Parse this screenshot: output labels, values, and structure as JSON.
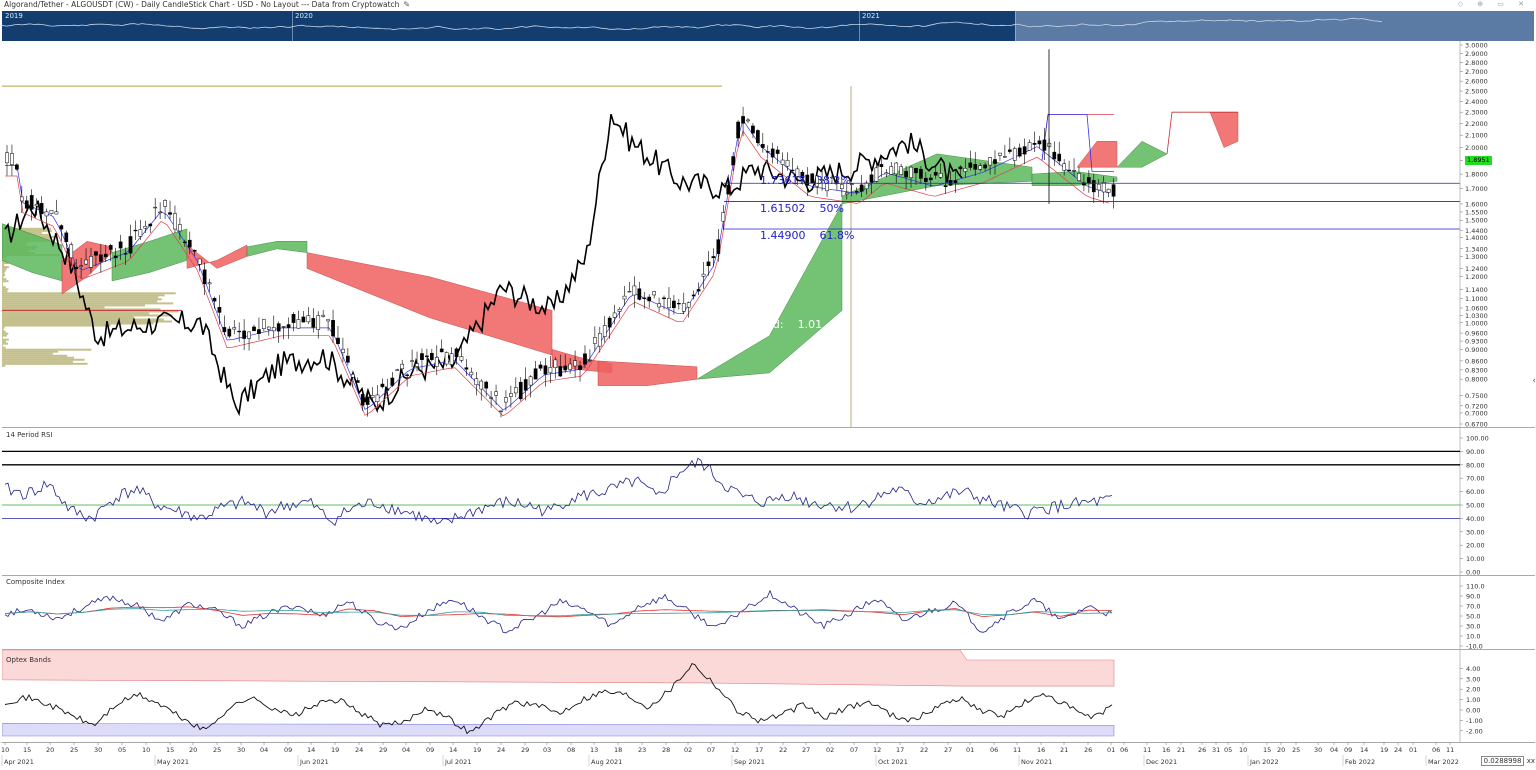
{
  "header": {
    "title": "Algorand/Tether - ALGOUSDT (CW) - Daily CandleStick Chart - USD - No Layout --- Data from Cryptowatch",
    "edit_icon": "pencil-icon",
    "window_icons": [
      "diamond-icon",
      "pin-icon",
      "restore-icon",
      "close-icon"
    ]
  },
  "navigator": {
    "years": [
      "2019",
      "2020",
      "2021"
    ]
  },
  "colors": {
    "kumo_bull": "#5cb85c",
    "kumo_bear": "#f06060",
    "tenkan": "#3333ee",
    "kijun": "#e04050",
    "price_line": "#000000",
    "fib_line": "#2222cc",
    "last_price_bg": "#22dd22",
    "nav_bg": "#133d6e"
  },
  "main_panel": {
    "price_axis": [
      "3.0000",
      "2.9000",
      "2.8000",
      "2.7000",
      "2.6000",
      "2.5000",
      "2.4000",
      "2.3000",
      "2.2000",
      "2.1000",
      "2.0000",
      "1.9000",
      "1.8000",
      "1.7000",
      "1.6000",
      "1.5500",
      "1.5000",
      "1.4400",
      "1.4000",
      "1.3400",
      "1.3000",
      "1.2400",
      "1.2000",
      "1.1400",
      "1.1000",
      "1.0600",
      "1.0300",
      "1.0000",
      "0.9600",
      "0.9300",
      "0.9000",
      "0.8600",
      "0.8300",
      "0.8000",
      "0.7500",
      "0.7200",
      "0.7000",
      "0.6700"
    ],
    "last_price": "1.8951",
    "fib_levels": [
      {
        "value": "1.73617",
        "pct": "38.2%"
      },
      {
        "value": "1.61502",
        "pct": "50%"
      },
      {
        "value": "1.44900",
        "pct": "61.8%"
      }
    ],
    "end_label": "End:",
    "end_value": "1.01"
  },
  "rsi_panel": {
    "name": "14 Period RSI",
    "axis": [
      "100.00",
      "90.00",
      "80.00",
      "70.00",
      "60.00",
      "50.00",
      "40.00",
      "30.00",
      "20.00",
      "10.00",
      "0.00"
    ]
  },
  "composite_panel": {
    "name": "Composite Index",
    "axis": [
      "110.0",
      "90.0",
      "70.0",
      "50.0",
      "30.0",
      "10.0",
      "-10.0"
    ]
  },
  "optex_panel": {
    "name": "Optex Bands",
    "axis": [
      "4.00",
      "3.00",
      "2.00",
      "1.00",
      "0.00",
      "-1.00",
      "-2.00"
    ]
  },
  "x_axis": {
    "days": [
      "10",
      "15",
      "20",
      "25",
      "30",
      "05",
      "10",
      "15",
      "20",
      "25",
      "30",
      "04",
      "09",
      "14",
      "19",
      "24",
      "29",
      "04",
      "09",
      "14",
      "19",
      "24",
      "29",
      "03",
      "08",
      "13",
      "18",
      "23",
      "28",
      "02",
      "07",
      "12",
      "17",
      "22",
      "27",
      "02",
      "07",
      "12",
      "17",
      "22",
      "27",
      "01",
      "06",
      "11",
      "16",
      "21",
      "26",
      "01",
      "06",
      "11",
      "16",
      "21",
      "26",
      "31",
      "05",
      "10",
      "15",
      "20",
      "25",
      "30",
      "04",
      "09",
      "14",
      "19",
      "24",
      "01",
      "06",
      "11"
    ],
    "months": [
      "Apr 2021",
      "May 2021",
      "Jun 2021",
      "Jul 2021",
      "Aug 2021",
      "Sep 2021",
      "Oct 2021",
      "Nov 2021",
      "Dec 2021",
      "Jan 2022",
      "Feb 2022",
      "Mar 2022"
    ],
    "corner_value": "0.0288998",
    "corner_icons": "xx"
  },
  "chart_data": [
    {
      "type": "candlestick",
      "title": "Algorand/Tether - ALGOUSDT (CW) - Daily CandleStick Chart - USD",
      "scale": "log",
      "ylim": [
        0.67,
        3.0
      ],
      "last_price": 1.8951,
      "indicators": [
        "Ichimoku Cloud",
        "Volume Profile",
        "Fibonacci Retracement"
      ],
      "fibonacci": [
        {
          "level": 0.382,
          "value": 1.73617
        },
        {
          "level": 0.5,
          "value": 1.61502
        },
        {
          "level": 0.618,
          "value": 1.449
        }
      ],
      "close_approx": [
        {
          "x": "2021-04-13",
          "y": 1.65
        },
        {
          "x": "2021-04-20",
          "y": 1.55
        },
        {
          "x": "2021-04-25",
          "y": 1.25
        },
        {
          "x": "2021-05-05",
          "y": 1.35
        },
        {
          "x": "2021-05-12",
          "y": 1.6
        },
        {
          "x": "2021-05-19",
          "y": 1.3
        },
        {
          "x": "2021-05-25",
          "y": 0.95
        },
        {
          "x": "2021-06-05",
          "y": 1.0
        },
        {
          "x": "2021-06-15",
          "y": 1.0
        },
        {
          "x": "2021-06-22",
          "y": 0.72
        },
        {
          "x": "2021-07-01",
          "y": 0.85
        },
        {
          "x": "2021-07-10",
          "y": 0.88
        },
        {
          "x": "2021-07-20",
          "y": 0.72
        },
        {
          "x": "2021-07-28",
          "y": 0.83
        },
        {
          "x": "2021-08-05",
          "y": 0.85
        },
        {
          "x": "2021-08-15",
          "y": 1.15
        },
        {
          "x": "2021-08-25",
          "y": 1.05
        },
        {
          "x": "2021-09-01",
          "y": 1.3
        },
        {
          "x": "2021-09-06",
          "y": 2.3
        },
        {
          "x": "2021-09-10",
          "y": 2.05
        },
        {
          "x": "2021-09-20",
          "y": 1.75
        },
        {
          "x": "2021-09-30",
          "y": 1.7
        },
        {
          "x": "2021-10-05",
          "y": 1.85
        },
        {
          "x": "2021-10-15",
          "y": 1.75
        },
        {
          "x": "2021-10-25",
          "y": 1.85
        },
        {
          "x": "2021-11-05",
          "y": 2.05
        },
        {
          "x": "2021-11-15",
          "y": 1.75
        },
        {
          "x": "2021-11-25",
          "y": 1.65
        },
        {
          "x": "2021-12-01",
          "y": 1.9
        }
      ]
    },
    {
      "type": "line",
      "title": "14 Period RSI",
      "ylim": [
        0,
        100
      ],
      "levels": [
        90,
        80,
        50,
        40
      ],
      "series": [
        {
          "values": [
            62,
            58,
            66,
            46,
            40,
            55,
            62,
            50,
            45,
            40,
            48,
            52,
            45,
            50,
            52,
            38,
            48,
            52,
            47,
            42,
            34,
            42,
            48,
            52,
            50,
            45,
            55,
            58,
            62,
            68,
            55,
            75,
            82,
            66,
            55,
            52,
            58,
            52,
            50,
            48,
            55,
            62,
            52,
            55,
            60,
            54,
            48,
            44,
            48,
            50,
            52,
            54
          ]
        }
      ]
    },
    {
      "type": "line",
      "title": "Composite Index",
      "ylim": [
        -10,
        110
      ],
      "series": [
        {
          "values": [
            55,
            62,
            45,
            68,
            88,
            70,
            40,
            75,
            60,
            30,
            55,
            72,
            50,
            80,
            40,
            25,
            60,
            85,
            50,
            20,
            45,
            78,
            62,
            30,
            70,
            88,
            55,
            25,
            65,
            95,
            60,
            30,
            55,
            85,
            40,
            60,
            75,
            20,
            55,
            82,
            40,
            70,
            50
          ]
        }
      ]
    },
    {
      "type": "line",
      "title": "Optex Bands",
      "ylim": [
        -2.5,
        5
      ],
      "series": [
        {
          "values": [
            0.8,
            1.2,
            0.5,
            -0.5,
            -1.5,
            0.5,
            1.5,
            0.5,
            -0.8,
            -2.0,
            0.0,
            1.2,
            0.3,
            -0.6,
            0.5,
            1.0,
            -0.2,
            -1.5,
            -1.2,
            0.3,
            -0.8,
            -2.2,
            -0.5,
            0.8,
            0.4,
            -0.3,
            1.0,
            1.8,
            1.5,
            0.3,
            2.0,
            4.5,
            2.5,
            0.0,
            -1.0,
            -0.5,
            0.5,
            -0.8,
            0.3,
            0.8,
            -0.5,
            -1.0,
            0.3,
            1.2,
            0.0,
            -0.6,
            0.8,
            1.5,
            0.2,
            -0.8,
            0.4
          ]
        }
      ]
    }
  ]
}
